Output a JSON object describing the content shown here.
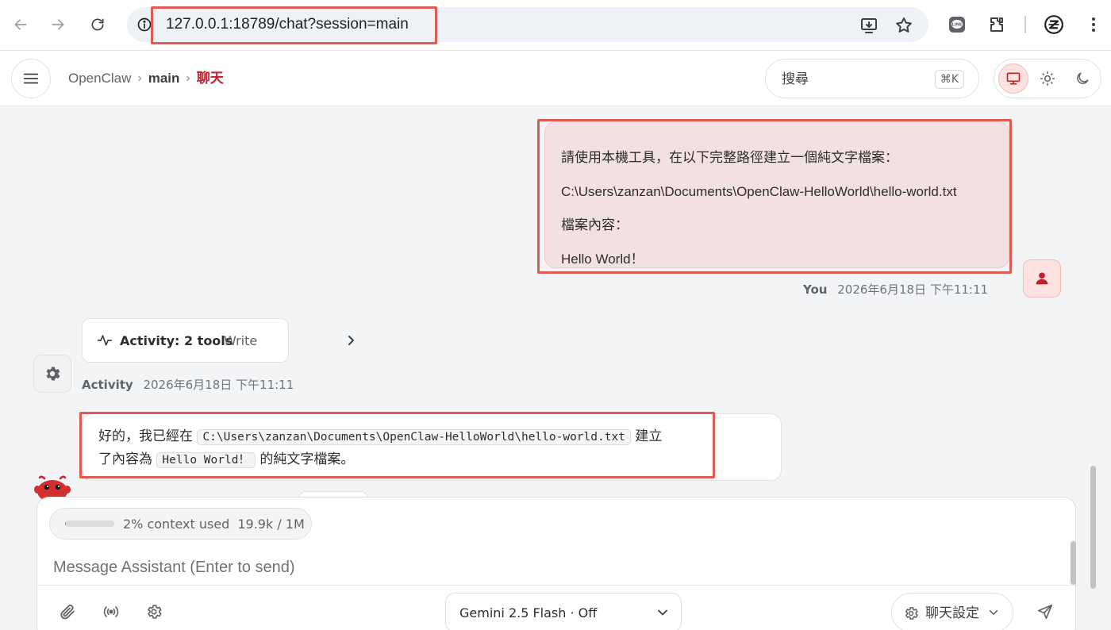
{
  "browser": {
    "url": "127.0.0.1:18789/chat?session=main"
  },
  "header": {
    "breadcrumb": [
      "OpenClaw",
      "main",
      "聊天"
    ],
    "search_placeholder": "搜尋",
    "search_shortcut": "⌘K"
  },
  "messages": {
    "user": {
      "lines": [
        "請使用本機工具，在以下完整路徑建立一個純文字檔案：",
        "C:\\Users\\zanzan\\Documents\\OpenClaw-HelloWorld\\hello-world.txt",
        "檔案內容：",
        "Hello World！"
      ],
      "author": "You",
      "timestamp": "2026年6月18日 下午11:11"
    },
    "activity": {
      "title": "Activity: 2 tools",
      "tool": "Write",
      "author": "Activity",
      "timestamp": "2026年6月18日 下午11:11"
    },
    "assistant": {
      "text_1": "好的，我已經在",
      "code_path": "C:\\Users\\zanzan\\Documents\\OpenClaw-HelloWorld\\hello-world.txt",
      "text_2": "建立",
      "text_3": "了內容為",
      "code_content": "Hello World！",
      "text_4": "的純文字檔案。"
    }
  },
  "composer": {
    "context_used_percent": 2,
    "context_label": "2% context used",
    "context_count": "19.9k / 1M",
    "placeholder": "Message Assistant (Enter to send)",
    "model": "Gemini 2.5 Flash · Off",
    "settings_label": "聊天設定"
  },
  "colors": {
    "accent": "#c0202b",
    "highlight": "#e05a52",
    "user_bubble": "#f3e0e2"
  }
}
